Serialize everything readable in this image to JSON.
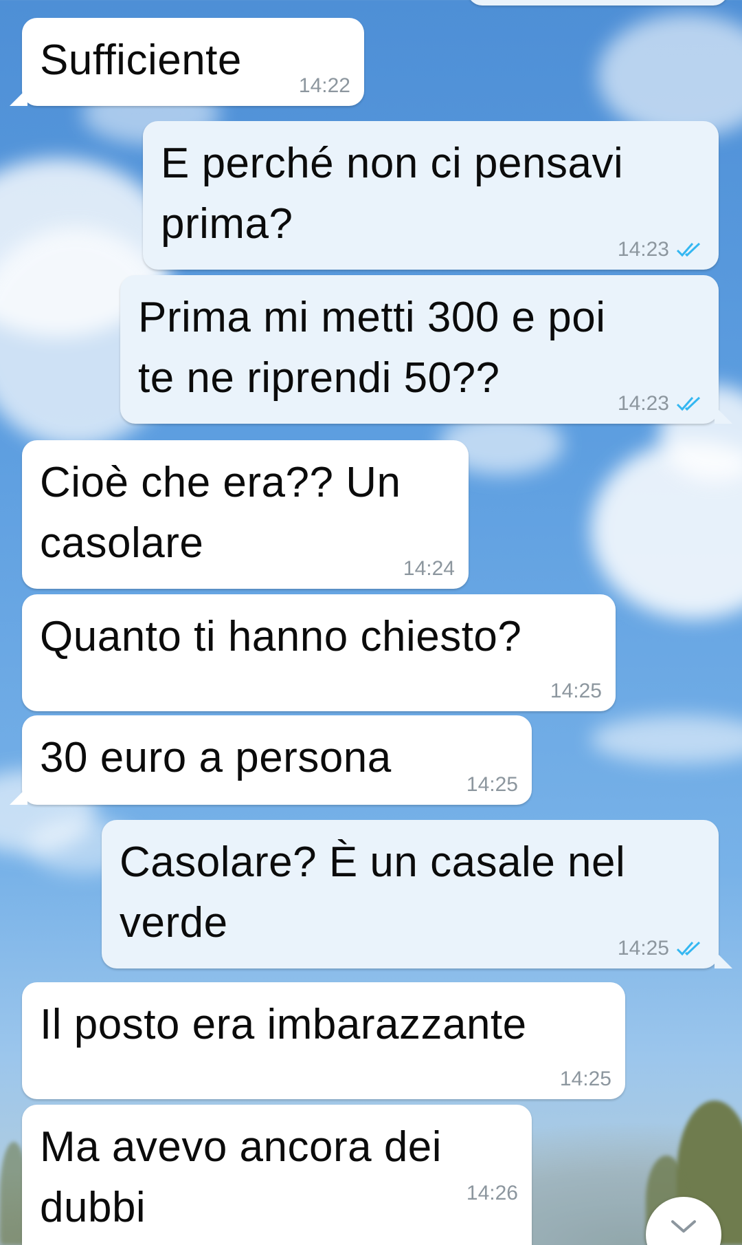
{
  "chat": {
    "messages": [
      {
        "direction": "in",
        "text": "Sufficiente",
        "time": "14:22"
      },
      {
        "direction": "out",
        "text": "E perché non ci pensavi prima?",
        "time": "14:23",
        "status": "read"
      },
      {
        "direction": "out",
        "text": "Prima mi metti 300 e poi te ne riprendi 50??",
        "time": "14:23",
        "status": "read"
      },
      {
        "direction": "in",
        "text": "Cioè che era?? Un casolare",
        "time": "14:24"
      },
      {
        "direction": "in",
        "text": "Quanto ti hanno chiesto?",
        "time": "14:25"
      },
      {
        "direction": "in",
        "text": "30 euro a persona",
        "time": "14:25"
      },
      {
        "direction": "out",
        "text": "Casolare? È un casale nel verde",
        "time": "14:25",
        "status": "read"
      },
      {
        "direction": "in",
        "text": "Il posto era imbarazzante",
        "time": "14:25"
      },
      {
        "direction": "in",
        "text": "Ma avevo ancora dei dubbi",
        "time": "14:26"
      }
    ],
    "lines": {
      "m2": [
        "E perché non ci pensavi",
        "prima?"
      ],
      "m3": [
        "Prima mi metti 300 e poi",
        "te ne riprendi 50??"
      ],
      "m4": [
        "Cioè che era?? Un",
        "casolare"
      ],
      "m7": [
        "Casolare? È un casale nel",
        "verde"
      ],
      "m9": [
        "Ma avevo ancora dei",
        "dubbi"
      ]
    }
  },
  "colors": {
    "incoming_bubble": "#ffffff",
    "outgoing_bubble": "#eaf3fb",
    "read_ticks": "#34b7f1",
    "timestamp": "#8c969e"
  },
  "icons": {
    "read_receipt": "double-check-icon",
    "scroll_down": "chevron-down-icon"
  }
}
